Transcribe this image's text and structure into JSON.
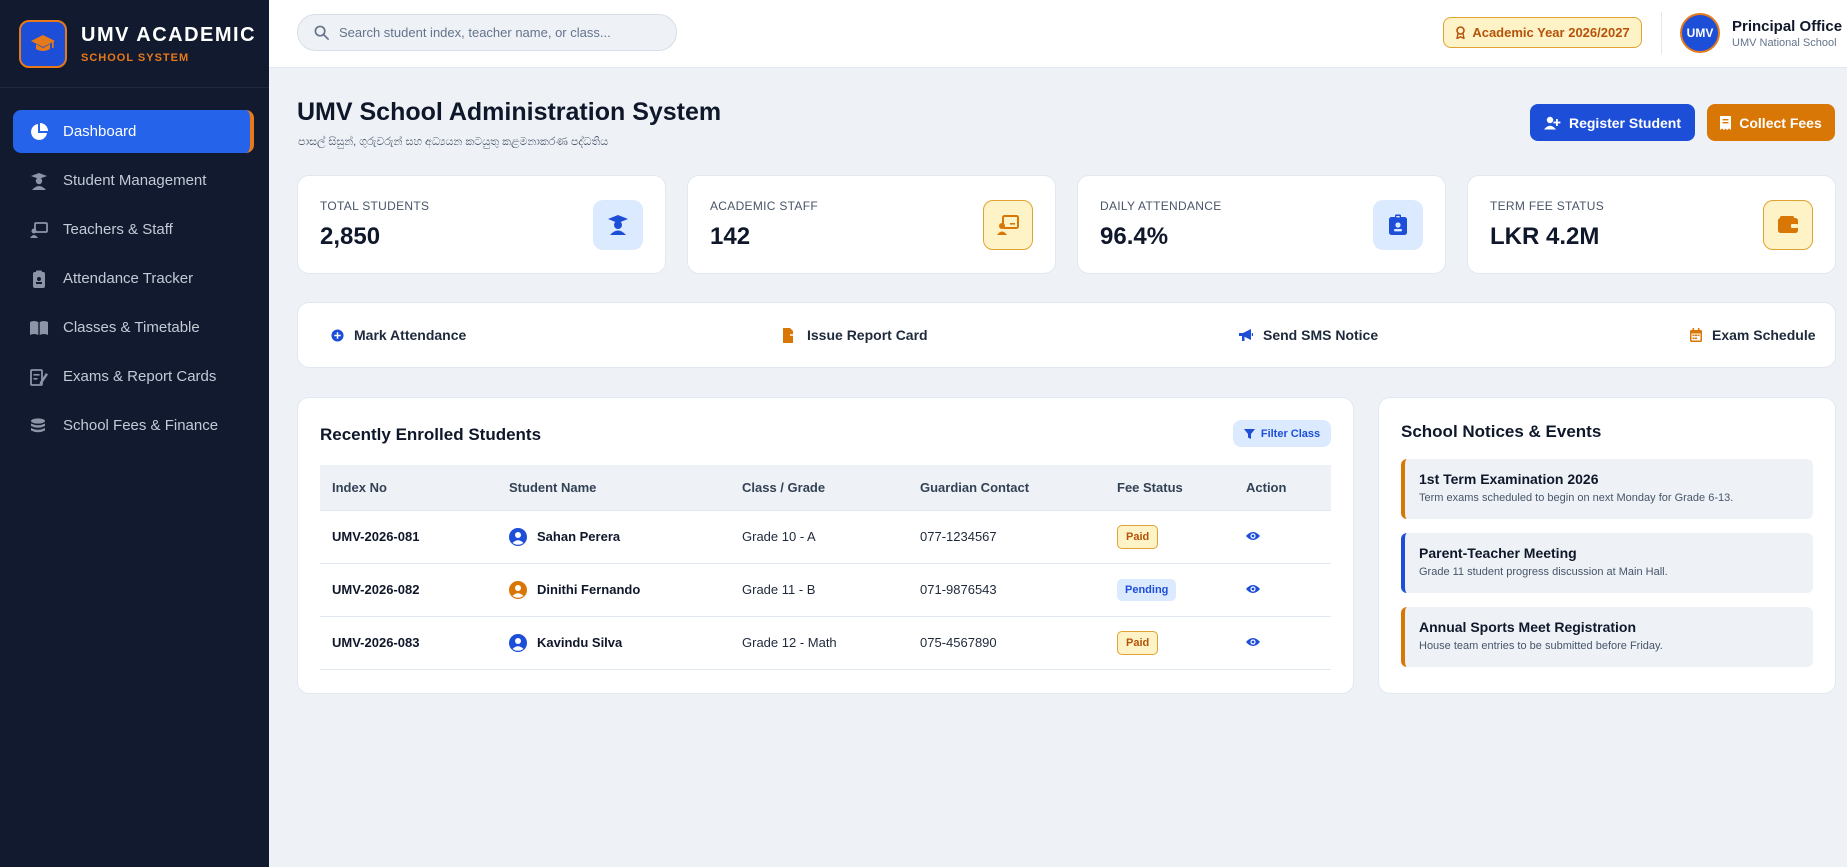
{
  "brand": {
    "title": "UMV ACADEMIC",
    "subtitle": "SCHOOL SYSTEM"
  },
  "sidebar": {
    "items": [
      {
        "label": "Dashboard",
        "icon": "pie-chart-icon",
        "active": true
      },
      {
        "label": "Student Management",
        "icon": "student-icon"
      },
      {
        "label": "Teachers & Staff",
        "icon": "teacher-board-icon"
      },
      {
        "label": "Attendance Tracker",
        "icon": "clipboard-icon"
      },
      {
        "label": "Classes & Timetable",
        "icon": "book-open-icon"
      },
      {
        "label": "Exams & Report Cards",
        "icon": "report-edit-icon"
      },
      {
        "label": "School Fees & Finance",
        "icon": "coins-icon"
      }
    ]
  },
  "header": {
    "search_placeholder": "Search student index, teacher name, or class...",
    "academic_year": "Academic Year 2026/2027",
    "profile": {
      "initials": "UMV",
      "name": "Principal Office",
      "school": "UMV National School"
    }
  },
  "page": {
    "title": "UMV School Administration System",
    "subtitle": "පාසල් සිසුන්, ගුරුවරුන් සහ අධ්‍යයන කටයුතු කළමනාකරණ පද්ධතිය",
    "register_label": "Register Student",
    "collect_label": "Collect Fees"
  },
  "stats": [
    {
      "label": "TOTAL STUDENTS",
      "value": "2,850",
      "icon": "graduate-icon"
    },
    {
      "label": "ACADEMIC STAFF",
      "value": "142",
      "icon": "teacher-board-icon"
    },
    {
      "label": "DAILY ATTENDANCE",
      "value": "96.4%",
      "icon": "id-badge-icon"
    },
    {
      "label": "TERM FEE STATUS",
      "value": "LKR 4.2M",
      "icon": "wallet-icon"
    }
  ],
  "quick_actions": [
    {
      "label": "Mark Attendance",
      "icon": "plus-circle-icon"
    },
    {
      "label": "Issue Report Card",
      "icon": "file-export-icon"
    },
    {
      "label": "Send SMS Notice",
      "icon": "megaphone-icon"
    },
    {
      "label": "Exam Schedule",
      "icon": "calendar-icon"
    }
  ],
  "students_panel": {
    "title": "Recently Enrolled Students",
    "filter_label": "Filter Class",
    "columns": [
      "Index No",
      "Student Name",
      "Class / Grade",
      "Guardian Contact",
      "Fee Status",
      "Action"
    ],
    "rows": [
      {
        "index": "UMV-2026-081",
        "name": "Sahan Perera",
        "grade": "Grade 10 - A",
        "contact": "077-1234567",
        "status": "Paid"
      },
      {
        "index": "UMV-2026-082",
        "name": "Dinithi Fernando",
        "grade": "Grade 11 - B",
        "contact": "071-9876543",
        "status": "Pending"
      },
      {
        "index": "UMV-2026-083",
        "name": "Kavindu Silva",
        "grade": "Grade 12 - Math",
        "contact": "075-4567890",
        "status": "Paid"
      }
    ]
  },
  "notices_panel": {
    "title": "School Notices & Events",
    "items": [
      {
        "title": "1st Term Examination 2026",
        "desc": "Term exams scheduled to begin on next Monday for Grade 6-13."
      },
      {
        "title": "Parent-Teacher Meeting",
        "desc": "Grade 11 student progress discussion at Main Hall."
      },
      {
        "title": "Annual Sports Meet Registration",
        "desc": "House team entries to be submitted before Friday."
      }
    ]
  },
  "colors": {
    "navy": "#111a2e",
    "blue": "#1d4ed8",
    "orange": "#d97706",
    "amber_bg": "#fef3c7"
  }
}
